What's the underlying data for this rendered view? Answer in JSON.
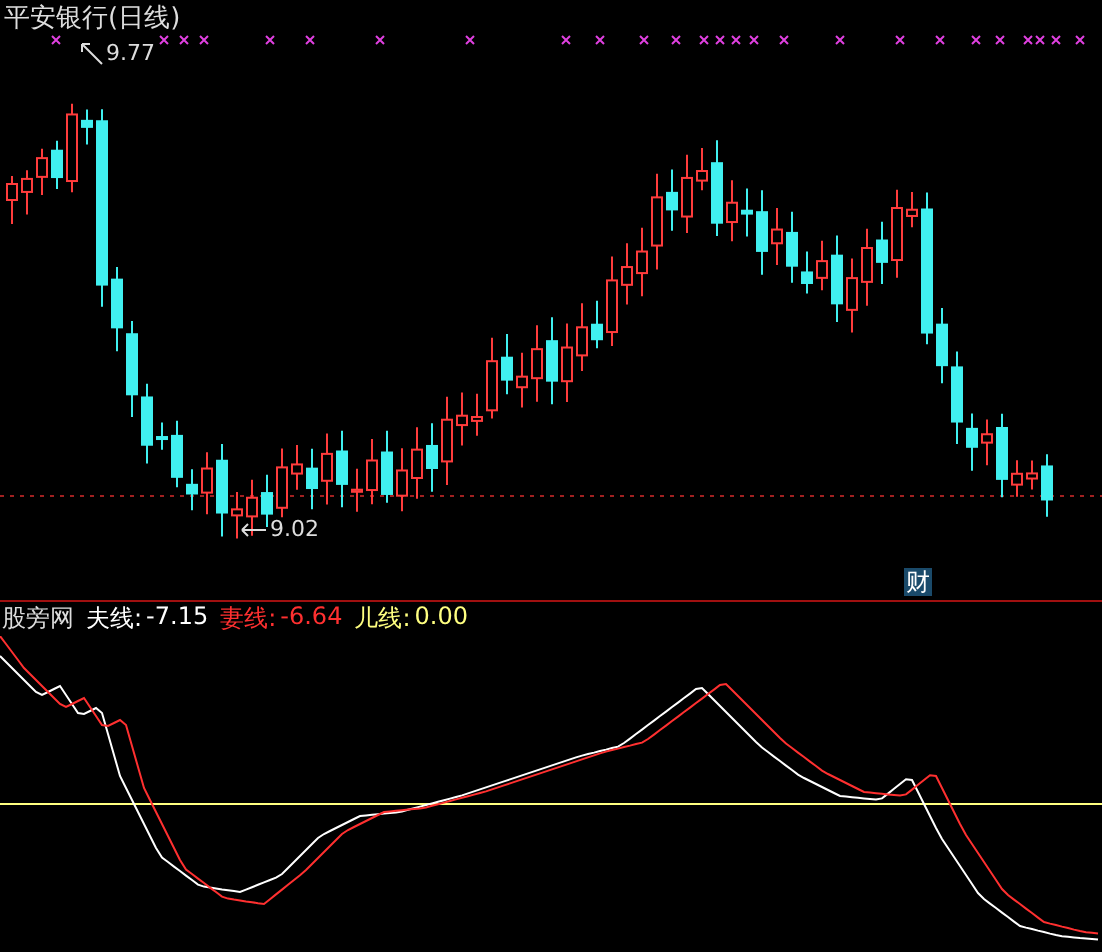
{
  "chart": {
    "title": "平安银行(日线)",
    "high_label": "9.77",
    "low_label": "9.02",
    "badge": "财"
  },
  "indicator": {
    "name": "股旁网",
    "lines": [
      {
        "label": "夫线:",
        "value": "-7.15",
        "color": "#ffffff"
      },
      {
        "label": "妻线:",
        "value": "-6.64",
        "color": "#ff3030"
      },
      {
        "label": "儿线:",
        "value": "0.00",
        "color": "#ffff80"
      }
    ]
  }
}
